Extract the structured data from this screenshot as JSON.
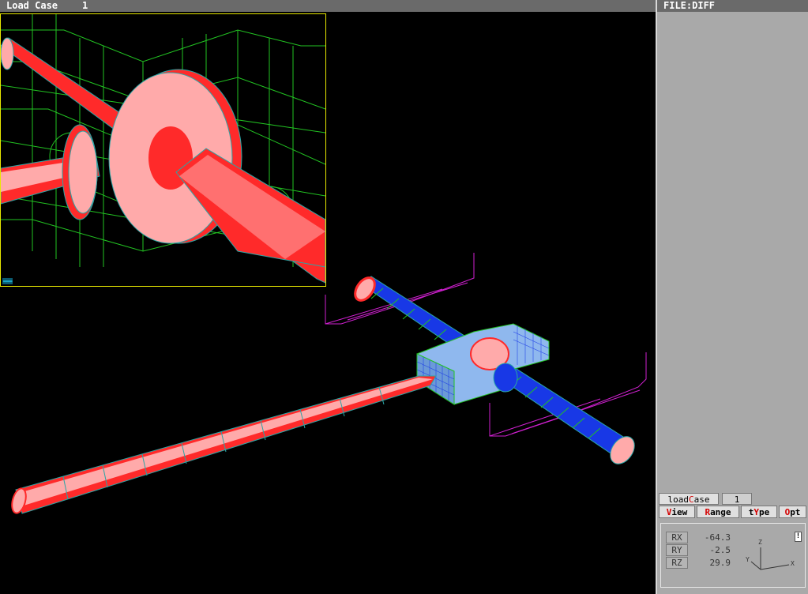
{
  "titlebar": {
    "label": "Load Case",
    "value": "1"
  },
  "filebar": {
    "label": "FILE:DIFF"
  },
  "loadcase": {
    "button": "loadCase",
    "value": "1"
  },
  "menu": [
    {
      "pre": "",
      "key": "V",
      "post": "iew"
    },
    {
      "pre": "",
      "key": "R",
      "post": "ange"
    },
    {
      "pre": "t",
      "key": "Y",
      "post": "pe"
    },
    {
      "pre": "",
      "key": "O",
      "post": "pt"
    }
  ],
  "rotation": {
    "rx_label": "RX",
    "rx": "-64.3",
    "ry_label": "RY",
    "ry": "-2.5",
    "rz_label": "RZ",
    "rz": "29.9"
  },
  "triad": {
    "z": "Z",
    "y": "Y",
    "x": "X"
  },
  "lock_icon": "lock-icon",
  "colors": {
    "mesh_green": "#22c322",
    "shaft_red": "#ff2a2a",
    "shaft_pink": "#ffaaaa",
    "blue": "#1838e6",
    "light_blue": "#8fb8ee",
    "magenta": "#d020d0",
    "teal": "#2aa6a6",
    "inset_border": "#e8e800"
  }
}
